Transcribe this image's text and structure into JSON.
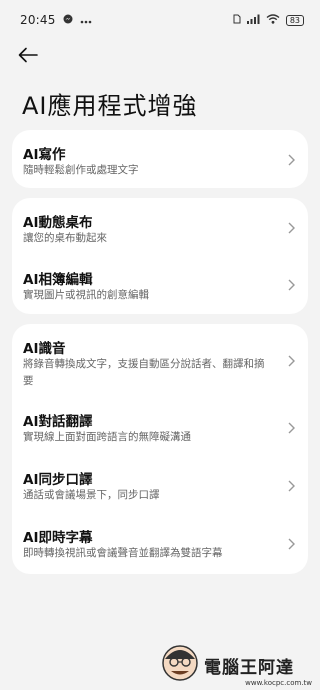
{
  "status_bar": {
    "time": "20:45",
    "battery": "83",
    "icons": [
      "messenger-icon",
      "more-dots-icon",
      "sim-icon",
      "signal-icon",
      "wifi-icon",
      "battery-icon"
    ]
  },
  "header": {
    "title": "AI應用程式增強",
    "back_icon": "back-arrow-icon"
  },
  "cards": [
    {
      "items": [
        {
          "title": "AI寫作",
          "subtitle": "隨時輕鬆創作或處理文字"
        }
      ]
    },
    {
      "items": [
        {
          "title": "AI動態桌布",
          "subtitle": "讓您的桌布動起來"
        },
        {
          "title": "AI相簿編輯",
          "subtitle": "實現圖片或視訊的創意編輯"
        }
      ]
    },
    {
      "items": [
        {
          "title": "AI識音",
          "subtitle_line1": "將錄音轉換成文字，支援自動區分說話者、翻譯和摘",
          "subtitle_line2": "要"
        },
        {
          "title": "AI對話翻譯",
          "subtitle": "實現線上面對面跨語言的無障礙溝通"
        },
        {
          "title": "AI同步口譯",
          "subtitle": "通話或會議場景下，同步口譯"
        },
        {
          "title": "AI即時字幕",
          "subtitle": "即時轉換視訊或會議聲音並翻譯為雙語字幕"
        }
      ]
    }
  ],
  "watermark": {
    "text": "電腦王阿達",
    "url": "www.kocpc.com.tw"
  }
}
